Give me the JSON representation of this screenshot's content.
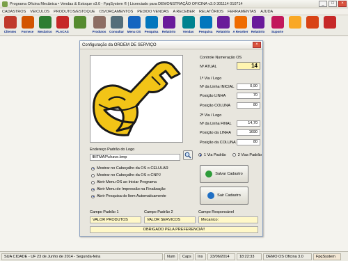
{
  "window": {
    "title": "Programa Oficina Mecânica • Vendas & Estoque v3.0 - FpqSystem ® | Licenciado para  DEMONSTRAÇÃO OFICINA v3.0  301114 010714",
    "controls": [
      "_",
      "□",
      "×"
    ]
  },
  "menu": [
    "CADASTROS",
    "VEICULOS",
    "PRODUTOS/ESTOQUE",
    "OS/ORÇAMENTOS",
    "PEDIDO VENDAS",
    "A RECEBER",
    "RELATÓRIOS",
    "FERRAMENTAS",
    "AJUDA"
  ],
  "toolbar": [
    {
      "label": "Clientes",
      "icon": "clients-icon",
      "color": "#c0392b"
    },
    {
      "label": "Fornece",
      "icon": "supplier-icon",
      "color": "#d35400"
    },
    {
      "label": "Mecânico",
      "icon": "mechanic-icon",
      "color": "#2e7d32"
    },
    {
      "label": "PLACAS",
      "icon": "car-icon",
      "color": "#c62828"
    },
    {
      "label": "",
      "icon": "alarm-clock-icon",
      "color": "#558b2f"
    },
    {
      "label": "Produtos",
      "icon": "products-icon",
      "color": "#8d6e63"
    },
    {
      "label": "Consultar",
      "icon": "consult-icon",
      "color": "#546e7a"
    },
    {
      "label": "Menu OS",
      "icon": "menu-os-icon",
      "color": "#1565c0"
    },
    {
      "label": "Pesquisa",
      "icon": "search-icon",
      "color": "#0277bd"
    },
    {
      "label": "Relatório",
      "icon": "report-icon",
      "color": "#6a1b9a"
    },
    {
      "label": "Vendas",
      "icon": "sales-icon",
      "color": "#00838f"
    },
    {
      "label": "Pesquisa",
      "icon": "search-icon",
      "color": "#0277bd"
    },
    {
      "label": "Relatório",
      "icon": "report-icon",
      "color": "#6a1b9a"
    },
    {
      "label": "A Receber",
      "icon": "receivable-icon",
      "color": "#ef6c00"
    },
    {
      "label": "Relatório",
      "icon": "report-icon",
      "color": "#6a1b9a"
    },
    {
      "label": "Suporte",
      "icon": "support-icon",
      "color": "#c2185b"
    },
    {
      "label": "",
      "icon": "money-icon",
      "color": "#f9a825"
    },
    {
      "label": "",
      "icon": "apps-icon",
      "color": "#d84315"
    },
    {
      "label": "",
      "icon": "power-icon",
      "color": "#c62828"
    }
  ],
  "dialog": {
    "title": "Configuração da ORDEM DE SERVIÇO",
    "close": "×",
    "numeracao_label": "Controle Numeração OS",
    "atual_label": "Nº ATUAL",
    "atual_value": "14",
    "via1_label": "1ª Via / Logo",
    "linha_inicial_label": "Nº da Linha INICIAL",
    "linha_inicial_value": "0,90",
    "posicao_linha_label": "Posição LINHA",
    "posicao_linha_value": "70",
    "posicao_coluna_label": "Posição COLUNA",
    "posicao_coluna_value": "80",
    "via2_label": "2ª Via / Logo",
    "linha_final_label": "Nº da Linha FINAL",
    "linha_final_value": "14,70",
    "posicao_da_linha_label": "Posição da LINHA",
    "posicao_da_linha_value": "1690",
    "posicao_da_coluna_label": "Posição da COLUNA",
    "posicao_da_coluna_value": "80",
    "logo_path_label": "Endereço Padrão do Logo",
    "logo_path_value": "\\BITMAP\\chave.bmp",
    "options": [
      {
        "label": "Mostrar no Cabeçalho da OS o CELULAR",
        "checked": true
      },
      {
        "label": "Mostrar no Cabeçalho da OS o CNPJ",
        "checked": false
      },
      {
        "label": "Abrir Menu OS ao Iniciar Programa",
        "checked": false
      },
      {
        "label": "Abrir Menu de Impressão na Finalização",
        "checked": true
      },
      {
        "label": "Abrir Pesquisa do Item Automaticamente",
        "checked": true
      }
    ],
    "via_options": [
      "1 Via Padrão",
      "2 Vias Padrão"
    ],
    "save_label": "Salvar Cadastro",
    "exit_label": "Sair Cadastro",
    "campo1_label": "Campo Padrão 1",
    "campo1_value": "VALOR PRODUTOS",
    "campo2_label": "Campo Padrão 2",
    "campo2_value": "VALOR SERVICOS",
    "responsavel_label": "Campo Responsável",
    "responsavel_value": "Mecanico:",
    "preferencia_value": "OBRIGADO PELA PREFERENCIA!!"
  },
  "status": {
    "city": "SUA CIDADE - UF 23 de Junho de 2014 - Segunda-feira",
    "num": "Num",
    "caps": "Caps",
    "ins": "Ins",
    "date": "23/06/2014",
    "time": "18:22:33",
    "version": "DEMO OS Oficina 3.0",
    "brand": "FpqSystem"
  },
  "colors": {
    "logo_yellow": "#f2c417",
    "logo_stroke": "#1a1a1a",
    "dialog_border": "#8aa0c0",
    "highlight_field": "#fff5b0"
  }
}
